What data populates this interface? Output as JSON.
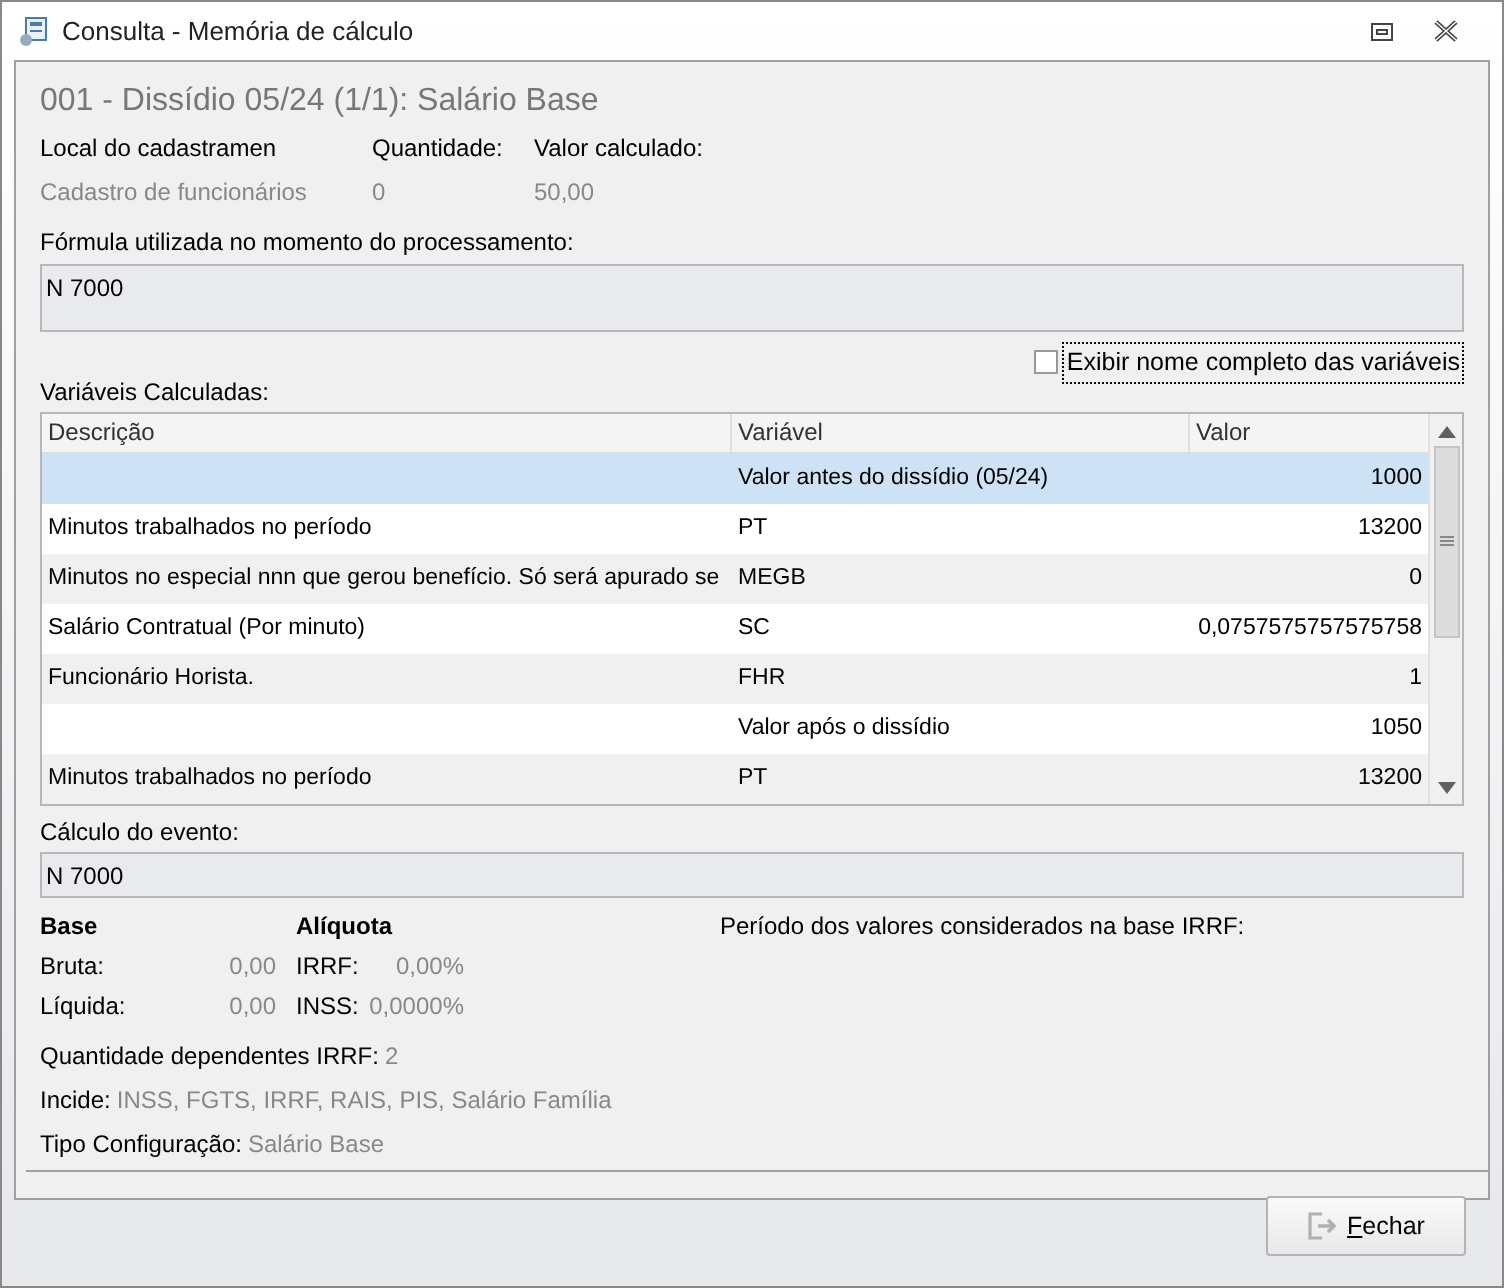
{
  "window": {
    "title": "Consulta - Memória de cálculo"
  },
  "heading": "001 - Dissídio 05/24 (1/1): Salário Base",
  "summary": [
    {
      "label": "Local do cadastramen",
      "value": "Cadastro de funcionários"
    },
    {
      "label": "Quantidade:",
      "value": "0"
    },
    {
      "label": "Valor calculado:",
      "value": "50,00"
    }
  ],
  "formula": {
    "label": "Fórmula utilizada no momento do processamento:",
    "value": "N 7000"
  },
  "full_names_checkbox": {
    "label": "Exibir nome completo das variáveis",
    "checked": false
  },
  "variables": {
    "label": "Variáveis Calculadas:",
    "columns": [
      "Descrição",
      "Variável",
      "Valor"
    ],
    "rows": [
      {
        "description": "",
        "variable": "Valor antes do dissídio (05/24)",
        "value": "1000",
        "selected": true
      },
      {
        "description": "Minutos trabalhados no período",
        "variable": "PT",
        "value": "13200",
        "selected": false
      },
      {
        "description": "Minutos no especial nnn que gerou benefício. Só será apurado se",
        "variable": "MEGB",
        "value": "0",
        "selected": false
      },
      {
        "description": "Salário Contratual (Por minuto)",
        "variable": "SC",
        "value": "0,0757575757575758",
        "selected": false
      },
      {
        "description": "Funcionário Horista.",
        "variable": "FHR",
        "value": "1",
        "selected": false
      },
      {
        "description": "",
        "variable": "Valor após o dissídio",
        "value": "1050",
        "selected": false
      },
      {
        "description": "Minutos trabalhados no período",
        "variable": "PT",
        "value": "13200",
        "selected": false
      }
    ]
  },
  "event_calc": {
    "label": "Cálculo do evento:",
    "value": "N 7000"
  },
  "base": {
    "title": "Base",
    "rows": [
      {
        "label": "Bruta:",
        "value": "0,00"
      },
      {
        "label": "Líquida:",
        "value": "0,00"
      }
    ]
  },
  "rate": {
    "title": "Alíquota",
    "rows": [
      {
        "label": "IRRF:",
        "value": "0,00%"
      },
      {
        "label": "INSS:",
        "value": "0,0000%"
      }
    ]
  },
  "irrf_period": {
    "label": "Período dos valores considerados na base IRRF:"
  },
  "details": [
    {
      "label": "Quantidade dependentes IRRF:",
      "value": "2"
    },
    {
      "label": "Incide:",
      "value": "INSS, FGTS, IRRF, RAIS, PIS, Salário Família"
    },
    {
      "label": "Tipo Configuração:",
      "value": "Salário Base"
    }
  ],
  "close_button": {
    "label": "Fechar",
    "mnemonic_first": true
  }
}
